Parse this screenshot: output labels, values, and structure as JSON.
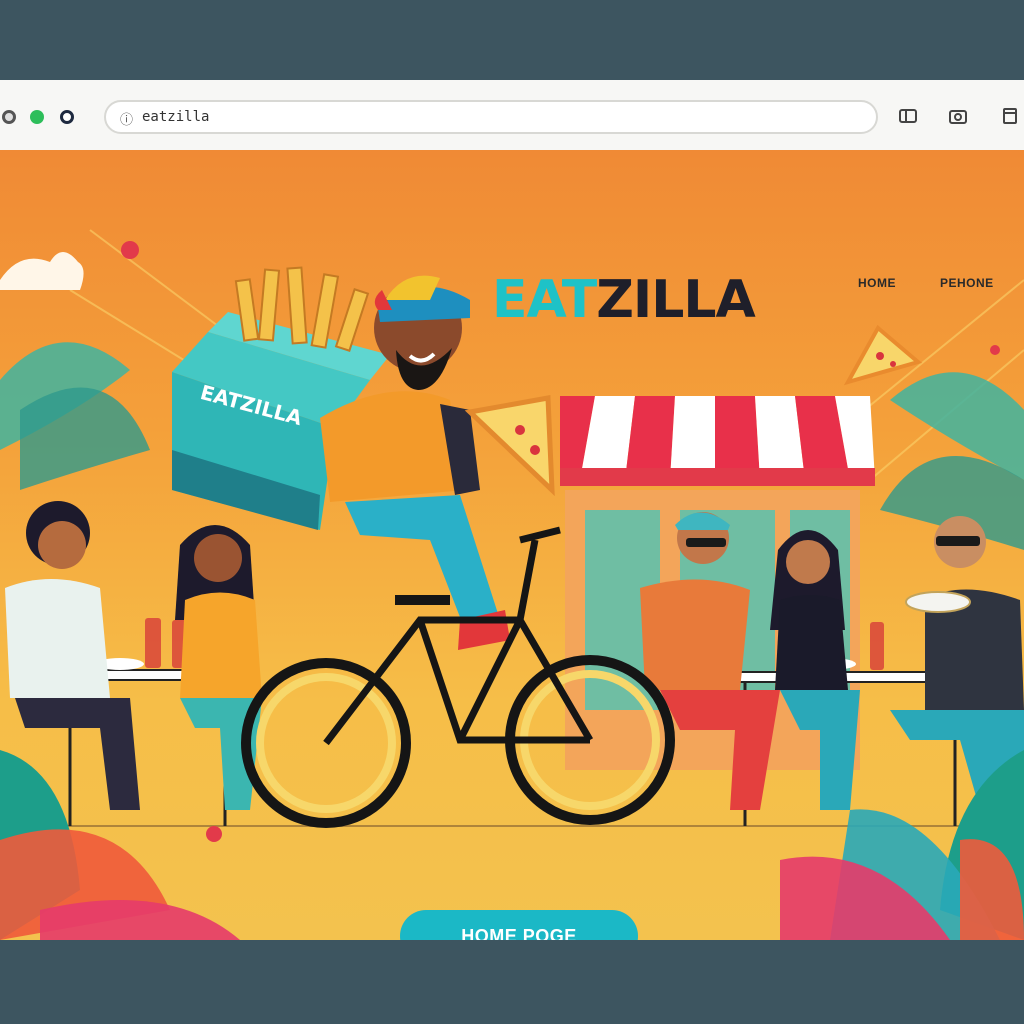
{
  "browser": {
    "url": "eatzilla"
  },
  "header": {
    "brand_part1": "EAT",
    "brand_part2": "ZILLA",
    "nav": [
      {
        "label": "HOME"
      },
      {
        "label": "PEHONE"
      }
    ]
  },
  "hero": {
    "bag_label": "EATZILLA",
    "cta_label": "HOME POGE"
  },
  "colors": {
    "accent": "#1ec2c7",
    "background_top": "#f08a35",
    "background_bottom": "#f3c24e"
  }
}
